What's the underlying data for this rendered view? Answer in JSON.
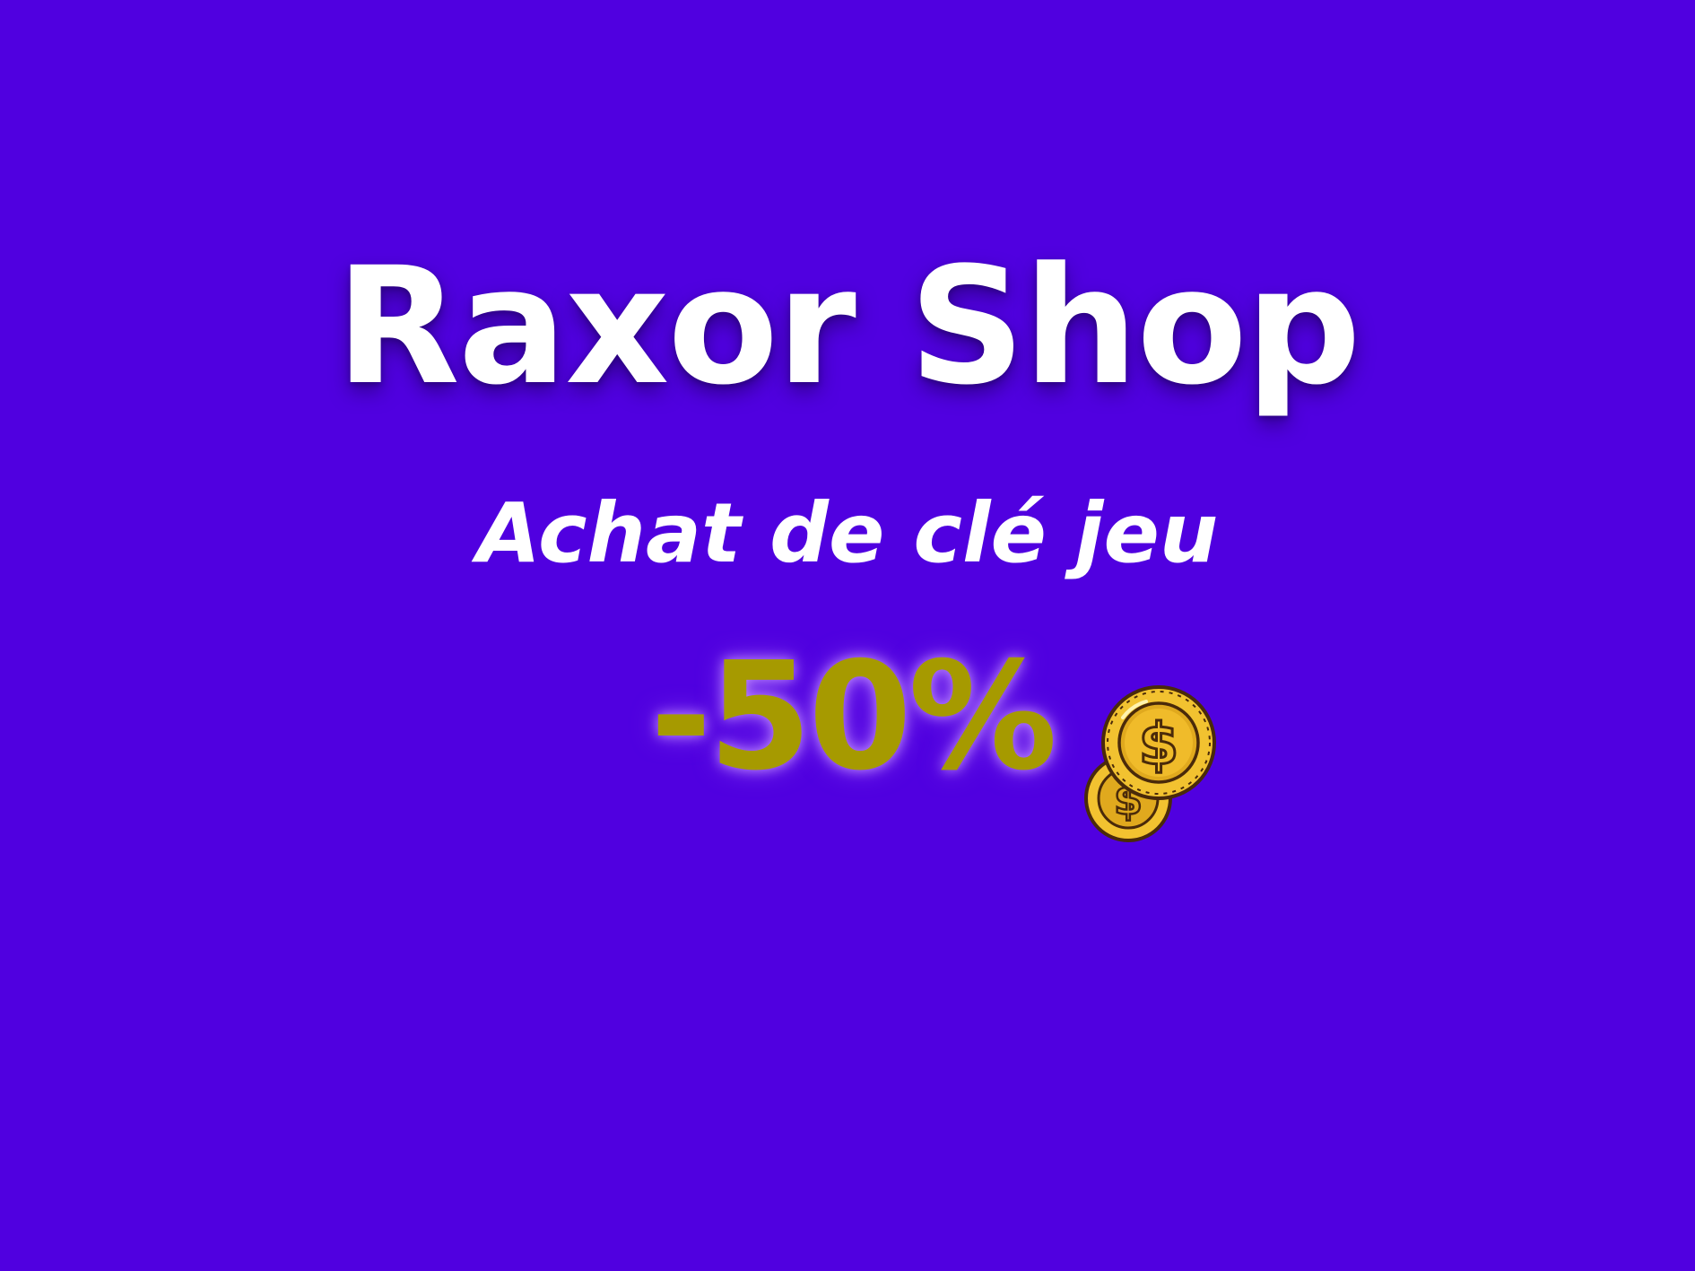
{
  "banner": {
    "title": "Raxor Shop",
    "subtitle": "Achat de clé jeu",
    "discount": "-50%"
  },
  "icons": {
    "coins": "coins-icon"
  },
  "colors": {
    "background": "#5000e0",
    "title_text": "#ffffff",
    "discount_text": "#a69a00",
    "coin_gold": "#f2c230",
    "coin_outline": "#4a2a0a"
  }
}
